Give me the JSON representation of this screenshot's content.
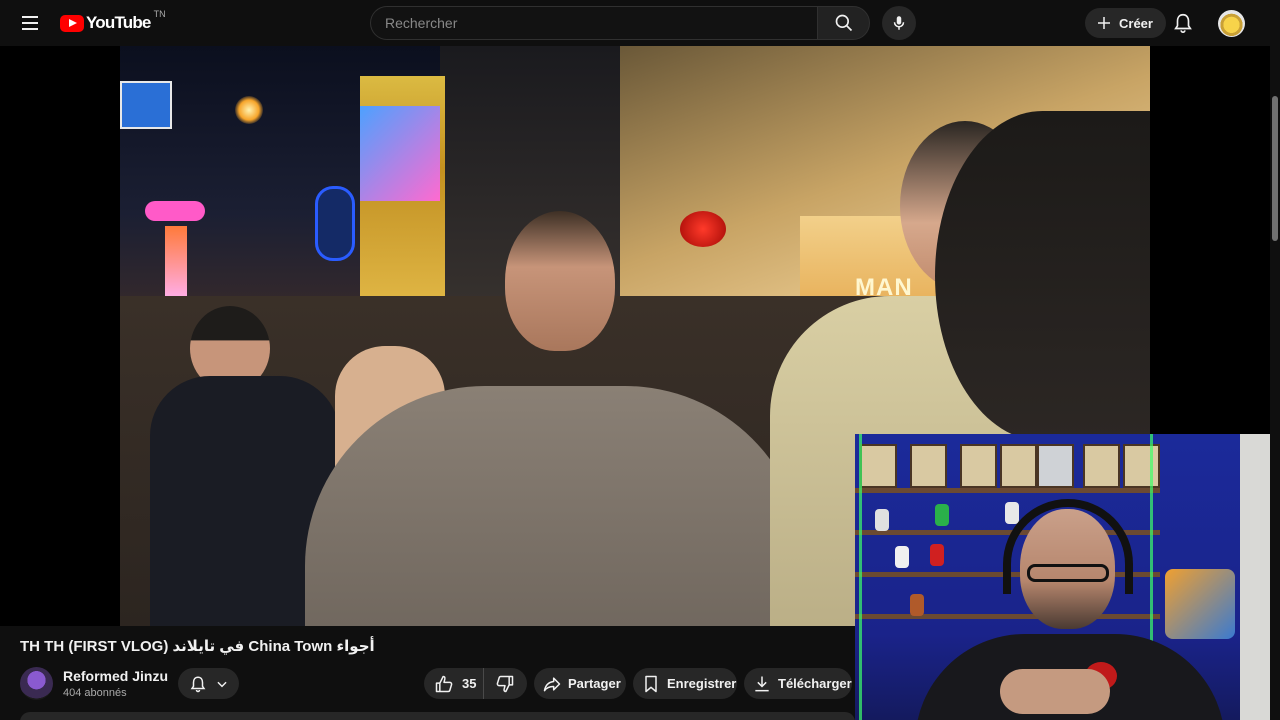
{
  "header": {
    "logo_text": "YouTube",
    "country_code": "TN",
    "search_placeholder": "Rechercher",
    "create_label": "Créer"
  },
  "video": {
    "title": "أجواء China Town في تايلاند (FIRST VLOG) TH TH",
    "frame_sign_text": "MAN"
  },
  "channel": {
    "name": "Reformed Jinzu",
    "subscribers": "404 abonnés"
  },
  "actions": {
    "like_count": "35",
    "share_label": "Partager",
    "save_label": "Enregistrer",
    "download_label": "Télécharger"
  },
  "icons": {
    "menu": "hamburger-menu-icon",
    "search": "search-icon",
    "mic": "microphone-icon",
    "create": "plus-icon",
    "bell": "bell-icon",
    "like": "thumbs-up-icon",
    "dislike": "thumbs-down-icon",
    "share": "share-arrow-icon",
    "save": "bookmark-icon",
    "download": "download-icon",
    "chevron": "chevron-down-icon"
  },
  "colors": {
    "background": "#0f0f0f",
    "pill": "#272727",
    "brand_red": "#ff0000",
    "text": "#f1f1f1",
    "muted": "#aaaaaa"
  }
}
